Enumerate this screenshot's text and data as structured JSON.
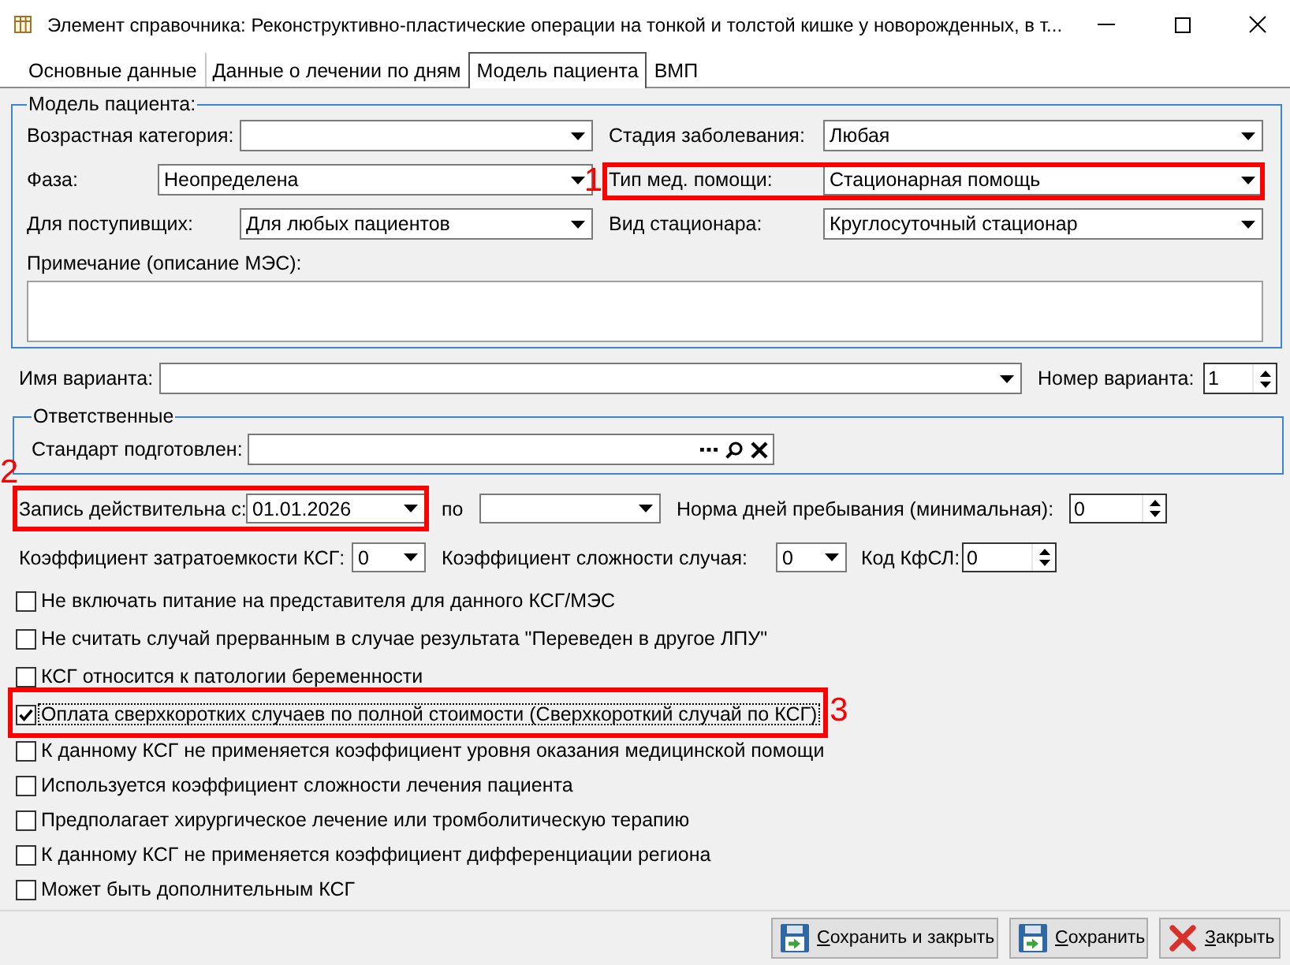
{
  "window": {
    "title": "Элемент справочника: Реконструктивно-пластические операции на тонкой и толстой кишке у новорожденных, в т..."
  },
  "tabs": [
    {
      "label": "Основные данные",
      "selected": false
    },
    {
      "label": "Данные о лечении по дням",
      "selected": false
    },
    {
      "label": "Модель пациента",
      "selected": true
    },
    {
      "label": "ВМП",
      "selected": false
    }
  ],
  "patient_model": {
    "title": "Модель пациента:",
    "rows": [
      {
        "left": {
          "label": "Возрастная категория:"
        },
        "right": {
          "label": "Стадия заболевания:",
          "value": "Любая"
        }
      },
      {
        "left": {
          "label": "Фаза:",
          "value": "Неопределена"
        },
        "right": {
          "label": "Тип мед. помощи:",
          "value": "Стационарная помощь",
          "callout": "1"
        }
      },
      {
        "left": {
          "label": "Для поступивщих:",
          "value": "Для любых пациентов"
        },
        "right": {
          "label": "Вид стационара:",
          "value": "Круглосуточный стационар"
        }
      }
    ],
    "note_label": "Примечание (описание МЭС):"
  },
  "variant": {
    "name_label": "Имя варианта:",
    "number_label": "Номер варианта:",
    "number": "1"
  },
  "responsible": {
    "title": "Ответственные",
    "prepared_by_label": "Стандарт подготовлен:"
  },
  "validity": {
    "from_label": "Запись действительна с:",
    "from": "01.01.2026",
    "callout": "2",
    "to_label": "по",
    "min_days_label": "Норма дней пребывания (минимальная):",
    "min_days": "0"
  },
  "coefficients": {
    "cost_label": "Коэффициент затратоемкости КСГ:",
    "cost": "0",
    "complexity_label": "Коэффициент сложности случая:",
    "complexity": "0",
    "kfsl_label": "Код КфСЛ:",
    "kfsl": "0"
  },
  "options": [
    {
      "label": "Не включать питание на представителя для данного КСГ/МЭС",
      "checked": false,
      "focused": false
    },
    {
      "label": "Не считать случай прерванным в случае результата \"Переведен в другое ЛПУ\"",
      "checked": false,
      "focused": false
    },
    {
      "label": "КСГ относится к патологии беременности",
      "checked": false,
      "focused": false
    },
    {
      "label": "Оплата сверхкоротких случаев по полной стоимости (Сверхкороткий случай по КСГ)",
      "checked": true,
      "focused": true,
      "callout": "3"
    },
    {
      "label": "К данному КСГ не применяется коэффициент уровня оказания медицинской помощи",
      "checked": false,
      "focused": false
    },
    {
      "label": "Используется коэффициент сложности лечения пациента",
      "checked": false,
      "focused": false
    },
    {
      "label": "Предполагает хирургическое лечение или тромболитическую терапию",
      "checked": false,
      "focused": false
    },
    {
      "label": "К данному КСГ не применяется коэффициент дифференциации региона",
      "checked": false,
      "focused": false
    },
    {
      "label": "Может быть дополнительным КСГ",
      "checked": false,
      "focused": false
    }
  ],
  "buttons": [
    {
      "kind": "save_close",
      "label": "Сохранить и закрыть",
      "access_key": true
    },
    {
      "kind": "save",
      "label": "Сохранить",
      "access_key": true
    },
    {
      "kind": "close",
      "label": "Закрыть",
      "access_key": true
    }
  ]
}
